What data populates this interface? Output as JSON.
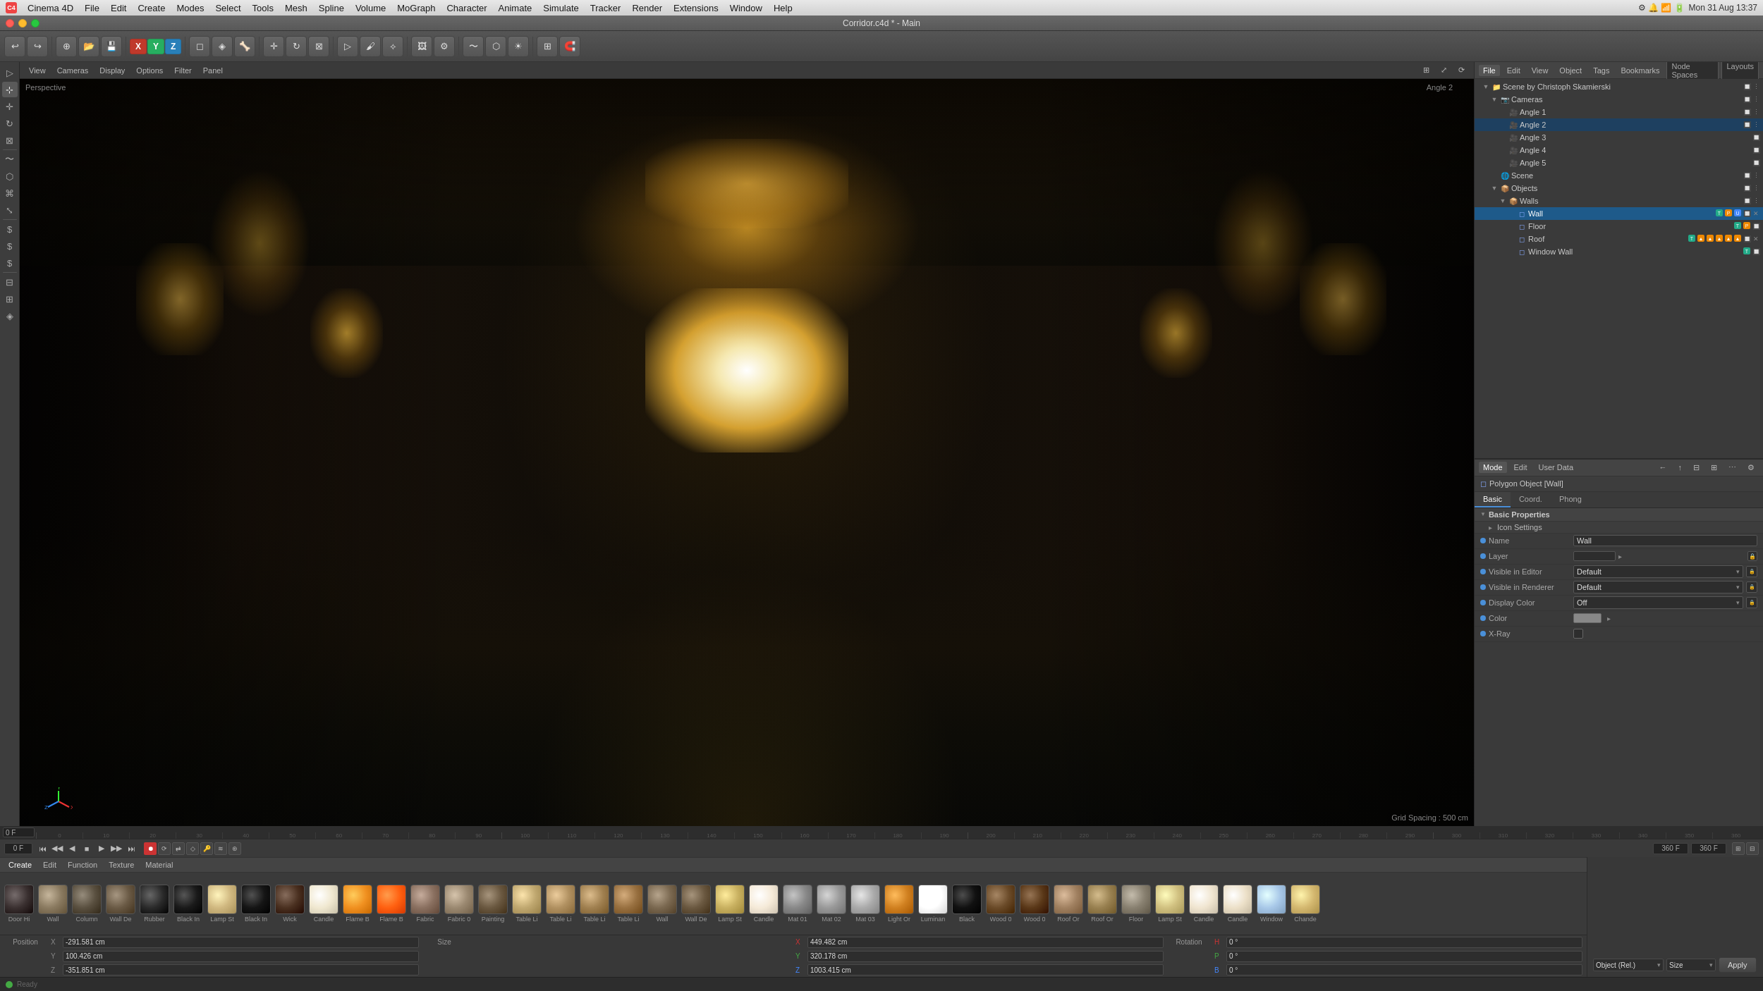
{
  "app": {
    "name": "Cinema 4D",
    "title": "Corridor.c4d * - Main",
    "date": "Mon 31 Aug  13:37"
  },
  "menubar": {
    "items": [
      "Cinema 4D",
      "File",
      "Edit",
      "Create",
      "Modes",
      "Select",
      "Tools",
      "Mesh",
      "Spline",
      "Volume",
      "MoGraph",
      "Character",
      "Animate",
      "Simulate",
      "Tracker",
      "Render",
      "Extensions",
      "Window",
      "Help"
    ]
  },
  "viewport": {
    "mode": "Perspective",
    "angle": "Angle 2",
    "grid_spacing": "Grid Spacing : 500 cm"
  },
  "viewport_toolbar": {
    "buttons": [
      "View",
      "Cameras",
      "Display",
      "Options",
      "Filter",
      "Panel"
    ]
  },
  "object_manager": {
    "tabs": [
      "File",
      "Edit",
      "View",
      "Object",
      "Tags",
      "Bookmarks"
    ],
    "node_spaces": "Node Spaces",
    "layouts": "Layouts",
    "tree": [
      {
        "id": "scene",
        "label": "Scene by Christoph Skamierski",
        "level": 0,
        "icon": "📁",
        "expanded": true
      },
      {
        "id": "cameras",
        "label": "Cameras",
        "level": 1,
        "icon": "📷",
        "expanded": true
      },
      {
        "id": "angle1",
        "label": "Angle 1",
        "level": 2,
        "icon": "🎥"
      },
      {
        "id": "angle2",
        "label": "Angle 2",
        "level": 2,
        "icon": "🎥",
        "active": true
      },
      {
        "id": "angle3",
        "label": "Angle 3",
        "level": 2,
        "icon": "🎥"
      },
      {
        "id": "angle4",
        "label": "Angle 4",
        "level": 2,
        "icon": "🎥"
      },
      {
        "id": "angle5",
        "label": "Angle 5",
        "level": 2,
        "icon": "🎥"
      },
      {
        "id": "scene2",
        "label": "Scene",
        "level": 1,
        "icon": "🌐"
      },
      {
        "id": "objects",
        "label": "Objects",
        "level": 1,
        "icon": "📦",
        "expanded": true
      },
      {
        "id": "walls",
        "label": "Walls",
        "level": 2,
        "icon": "📦"
      },
      {
        "id": "wall",
        "label": "Wall",
        "level": 3,
        "icon": "◻",
        "selected": true
      },
      {
        "id": "floor",
        "label": "Floor",
        "level": 3,
        "icon": "◻"
      },
      {
        "id": "roof",
        "label": "Roof",
        "level": 3,
        "icon": "◻"
      },
      {
        "id": "windowwall",
        "label": "Window Wall",
        "level": 3,
        "icon": "◻"
      }
    ]
  },
  "properties": {
    "header": "Mode  Edit  User Data",
    "object_type": "Polygon Object [Wall]",
    "tabs": [
      "Basic",
      "Coord.",
      "Phong"
    ],
    "active_tab": "Basic",
    "section": "Basic Properties",
    "subsection": "Icon Settings",
    "fields": [
      {
        "label": "Name",
        "value": "Wall",
        "type": "input"
      },
      {
        "label": "Layer",
        "value": "",
        "type": "layer"
      },
      {
        "label": "Visible in Editor",
        "value": "Default",
        "type": "dropdown"
      },
      {
        "label": "Visible in Renderer",
        "value": "Default",
        "type": "dropdown"
      },
      {
        "label": "Display Color",
        "value": "Off",
        "type": "dropdown"
      },
      {
        "label": "Color",
        "value": "",
        "type": "color"
      },
      {
        "label": "X-Ray",
        "value": "",
        "type": "checkbox"
      }
    ]
  },
  "timeline": {
    "frame_current": "0 F",
    "frame_end": "360 F",
    "frame_total": "360 F",
    "marks": [
      "0",
      "10",
      "20",
      "30",
      "40",
      "50",
      "60",
      "70",
      "80",
      "90",
      "100",
      "110",
      "120",
      "130",
      "140",
      "150",
      "160",
      "170",
      "180",
      "190",
      "200",
      "210",
      "220",
      "230",
      "240",
      "250",
      "260",
      "270",
      "280",
      "290",
      "300",
      "310",
      "320",
      "330",
      "340",
      "350",
      "360"
    ]
  },
  "playback": {
    "current_frame": "0 F",
    "end_frame": "360 F",
    "end_frame2": "360 F"
  },
  "material_bar": {
    "tabs": [
      "Create",
      "Edit",
      "Function",
      "Texture",
      "Material"
    ],
    "materials": [
      {
        "label": "Door Hi",
        "color": "#3a3030",
        "type": "dark"
      },
      {
        "label": "Wall",
        "color": "#8a7a60",
        "type": "med"
      },
      {
        "label": "Column",
        "color": "#5a5040",
        "type": "med"
      },
      {
        "label": "Wall De",
        "color": "#6a5a45",
        "type": "med"
      },
      {
        "label": "Rubber",
        "color": "#2a2a2a",
        "type": "dark"
      },
      {
        "label": "Black In",
        "color": "#1a1a1a",
        "type": "dark"
      },
      {
        "label": "Lamp St",
        "color": "#d0b880",
        "type": "light"
      },
      {
        "label": "Black In",
        "color": "#151515",
        "type": "dark"
      },
      {
        "label": "Wick",
        "color": "#4a3020",
        "type": "dark"
      },
      {
        "label": "Candle",
        "color": "#f0e8d0",
        "type": "white"
      },
      {
        "label": "Flame B",
        "color": "#f09020",
        "type": "orange"
      },
      {
        "label": "Flame B",
        "color": "#ff6010",
        "type": "orange2"
      },
      {
        "label": "Fabric",
        "color": "#8a7060",
        "type": "fabric"
      },
      {
        "label": "Fabric 0",
        "color": "#9a8870",
        "type": "fabric2"
      },
      {
        "label": "Painting",
        "color": "#6a5840",
        "type": "dark2"
      },
      {
        "label": "Table Li",
        "color": "#c0a870",
        "type": "wood"
      },
      {
        "label": "Table Li",
        "color": "#b09060",
        "type": "wood2"
      },
      {
        "label": "Table Li",
        "color": "#a08050",
        "type": "wood3"
      },
      {
        "label": "Table Li",
        "color": "#987040",
        "type": "wood4"
      },
      {
        "label": "Wall",
        "color": "#7a6850",
        "type": "wall"
      },
      {
        "label": "Wall De",
        "color": "#6a5840",
        "type": "wallde"
      },
      {
        "label": "Lamp St",
        "color": "#c8b060",
        "type": "lamp"
      },
      {
        "label": "Candle",
        "color": "#f5ead8",
        "type": "candle"
      },
      {
        "label": "Mat 01",
        "color": "#888888",
        "type": "grey"
      },
      {
        "label": "Mat 02",
        "color": "#999999",
        "type": "grey2"
      },
      {
        "label": "Mat 03",
        "color": "#aaaaaa",
        "type": "grey3"
      },
      {
        "label": "Light Or",
        "color": "#d08020",
        "type": "orange3"
      },
      {
        "label": "Luminan",
        "color": "#ffffff",
        "type": "white2"
      },
      {
        "label": "Black",
        "color": "#111111",
        "type": "black"
      },
      {
        "label": "Wood 0",
        "color": "#6a4a28",
        "type": "woodd"
      },
      {
        "label": "Wood 0",
        "color": "#5a3818",
        "type": "woodd2"
      },
      {
        "label": "Roof Or",
        "color": "#a08060",
        "type": "roof"
      },
      {
        "label": "Roof Or",
        "color": "#988050",
        "type": "roof2"
      },
      {
        "label": "Floor",
        "color": "#888070",
        "type": "floor"
      },
      {
        "label": "Lamp St",
        "color": "#d0c080",
        "type": "lamp2"
      },
      {
        "label": "Candle",
        "color": "#f0e5d0",
        "type": "candle2"
      },
      {
        "label": "Candle",
        "color": "#ece0c8",
        "type": "candle3"
      },
      {
        "label": "Window",
        "color": "#a8c8e8",
        "type": "window"
      },
      {
        "label": "Chande",
        "color": "#d4b870",
        "type": "chande"
      }
    ]
  },
  "coordinates": {
    "position": {
      "label": "Position",
      "x_label": "X",
      "x_value": "-291.581 cm",
      "y_label": "Y",
      "y_value": "100.426 cm",
      "z_label": "Z",
      "z_value": "-351.851 cm"
    },
    "size": {
      "label": "Size",
      "x_label": "X",
      "x_value": "449.482 cm",
      "y_label": "Y",
      "y_value": "320.178 cm",
      "z_label": "Z",
      "z_value": "1003.415 cm"
    },
    "rotation": {
      "label": "Rotation",
      "h_label": "H",
      "h_value": "0 °",
      "p_label": "P",
      "p_value": "0 °",
      "b_label": "B",
      "b_value": "0 °"
    },
    "apply_label": "Apply",
    "object_ref": "Object (Rel.)",
    "size_mode": "Size"
  },
  "icons": {
    "arrow_left": "←",
    "arrow_right": "→",
    "arrow_up": "↑",
    "arrow_down": "↓",
    "gear": "⚙",
    "eye": "👁",
    "camera": "📷",
    "folder": "📁",
    "triangle_right": "▶",
    "triangle_down": "▼",
    "play": "▶",
    "pause": "⏸",
    "stop": "⏹",
    "skip_start": "⏮",
    "skip_end": "⏭",
    "prev_frame": "⏪",
    "next_frame": "⏩",
    "record": "⏺",
    "checkmark": "✓",
    "chevron_down": "▾",
    "chevron_right": "▸",
    "close": "✕",
    "pin": "📌",
    "lock": "🔒",
    "dot": "●",
    "circle": "○"
  }
}
